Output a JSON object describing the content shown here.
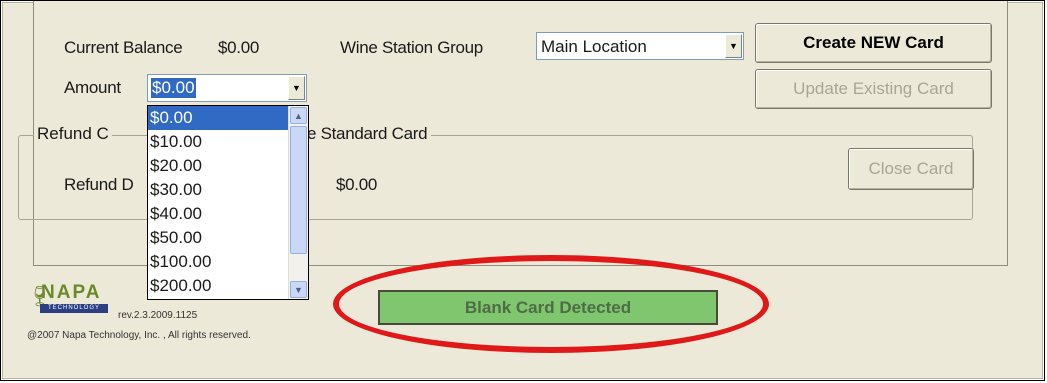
{
  "form": {
    "balance_label": "Current Balance",
    "balance_value": "$0.00",
    "group_label": "Wine Station Group",
    "group_value": "Main Location",
    "amount_label": "Amount",
    "amount_value": "$0.00"
  },
  "buttons": {
    "create": "Create NEW Card",
    "update": "Update Existing Card",
    "close": "Close Card"
  },
  "refund": {
    "group_title_start": "Refund C",
    "group_title_end": "e Standard Card",
    "row_label": "Refund D",
    "row_value": "$0.00"
  },
  "amount_options": [
    "$0.00",
    "$10.00",
    "$20.00",
    "$30.00",
    "$40.00",
    "$50.00",
    "$100.00",
    "$200.00"
  ],
  "status": {
    "text": "Blank Card Detected",
    "color": "#7fc66f"
  },
  "footer": {
    "logo_name": "NAPA",
    "logo_tagline": "TECHNOLOGY",
    "version": "rev.2.3.2009.1125",
    "copyright": "@2007 Napa Technology, Inc. , All rights reserved."
  },
  "highlight": {
    "color": "#e01818"
  }
}
